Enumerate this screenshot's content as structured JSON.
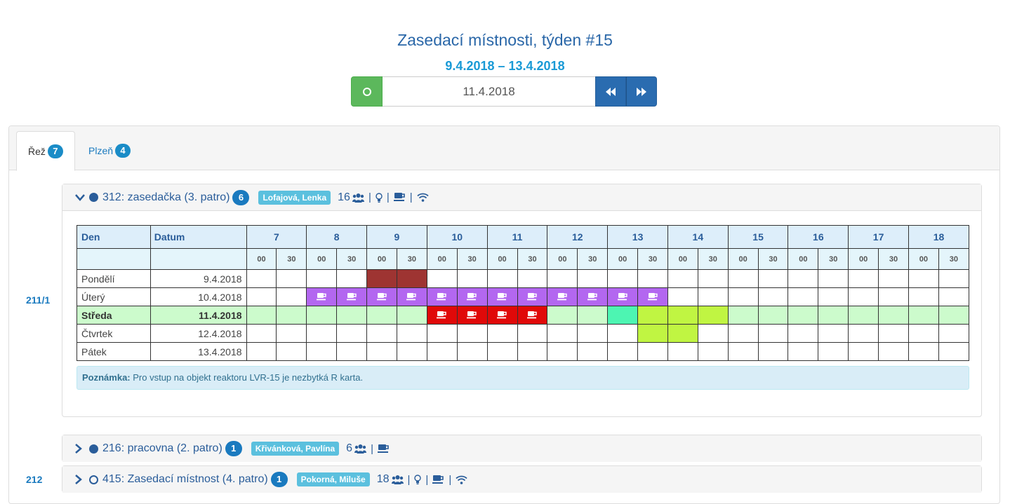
{
  "header": {
    "title": "Zasedací místnosti, týden #15",
    "range": "9.4.2018 – 13.4.2018",
    "date_value": "11.4.2018"
  },
  "tabs": [
    {
      "label": "Řež",
      "count": "7",
      "active": true
    },
    {
      "label": "Plzeň",
      "count": "4",
      "active": false
    }
  ],
  "floors": [
    "211/1",
    "212"
  ],
  "rooms": [
    {
      "name": "312: zasedačka (3. patro)",
      "count": "6",
      "owner": "Lofajová, Lenka",
      "capacity": "16",
      "expanded": true,
      "status": "filled-dot",
      "equipment": [
        "people-icon",
        "bulb-icon",
        "coffee-icon",
        "wifi-icon"
      ]
    },
    {
      "name": "216: pracovna (2. patro)",
      "count": "1",
      "owner": "Křivánková, Pavlína",
      "capacity": "6",
      "expanded": false,
      "status": "filled-dot",
      "equipment": [
        "people-icon",
        "coffee-icon"
      ]
    },
    {
      "name": "415: Zasedací místnost (4. patro)",
      "count": "1",
      "owner": "Pokorná, Miluše",
      "capacity": "18",
      "expanded": false,
      "status": "hollow-dot",
      "equipment": [
        "people-icon",
        "bulb-icon",
        "coffee-icon",
        "wifi-icon"
      ]
    }
  ],
  "schedule": {
    "col_den": "Den",
    "col_datum": "Datum",
    "hours": [
      "7",
      "8",
      "9",
      "10",
      "11",
      "12",
      "13",
      "14",
      "15",
      "16",
      "17",
      "18"
    ],
    "half_labels": [
      "00",
      "30"
    ],
    "days": [
      {
        "name": "Pondělí",
        "date": "9.4.2018"
      },
      {
        "name": "Úterý",
        "date": "10.4.2018"
      },
      {
        "name": "Středa",
        "date": "11.4.2018",
        "today": true
      },
      {
        "name": "Čtvrtek",
        "date": "12.4.2018"
      },
      {
        "name": "Pátek",
        "date": "13.4.2018"
      }
    ],
    "bookings": [
      {
        "day": 0,
        "from": "9:00",
        "to": "10:00",
        "color": "#9e3432",
        "coffee": false
      },
      {
        "day": 1,
        "from": "8:00",
        "to": "14:00",
        "color": "#b367f0",
        "coffee": true
      },
      {
        "day": 2,
        "from": "10:00",
        "to": "12:00",
        "color": "#e00909",
        "coffee": true
      },
      {
        "day": 2,
        "from": "13:00",
        "to": "13:30",
        "color": "#4df5b2",
        "coffee": false
      },
      {
        "day": 2,
        "from": "13:30",
        "to": "15:00",
        "color": "#c0f542",
        "coffee": false
      },
      {
        "day": 3,
        "from": "13:30",
        "to": "14:30",
        "color": "#c0f542",
        "coffee": false
      }
    ]
  },
  "note": {
    "label": "Poznámka:",
    "text": " Pro vstup na objekt reaktoru LVR-15 je nezbytká R karta."
  }
}
